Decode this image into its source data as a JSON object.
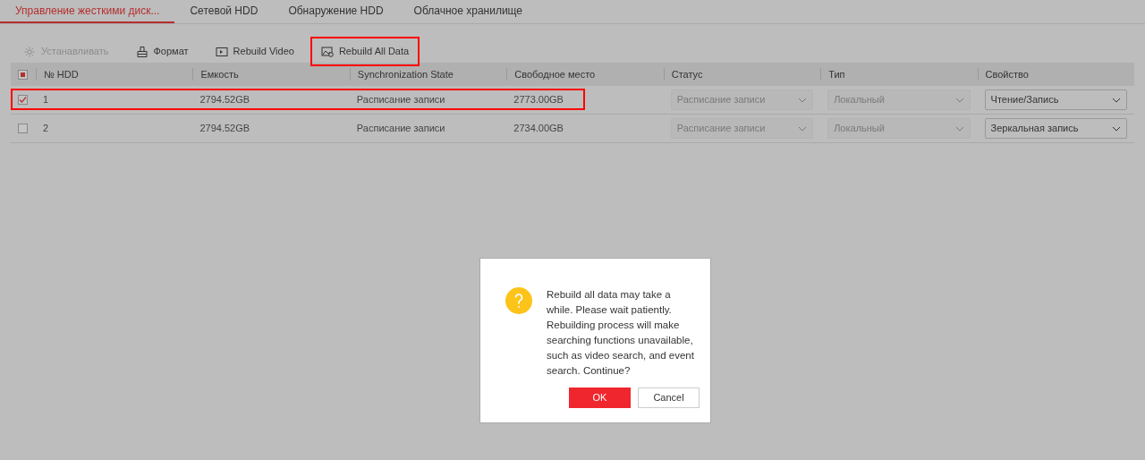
{
  "tabs": [
    {
      "label": "Управление жесткими диск...",
      "selected": true
    },
    {
      "label": "Сетевой HDD",
      "selected": false
    },
    {
      "label": "Обнаружение HDD",
      "selected": false
    },
    {
      "label": "Облачное хранилище",
      "selected": false
    }
  ],
  "toolbar": [
    {
      "label": "Устанавливать",
      "disabled": true,
      "highlighted": false
    },
    {
      "label": "Формат",
      "disabled": false,
      "highlighted": false
    },
    {
      "label": "Rebuild Video",
      "disabled": false,
      "highlighted": false
    },
    {
      "label": "Rebuild All Data",
      "disabled": false,
      "highlighted": true
    }
  ],
  "table": {
    "select_all": {
      "indeterminate": true
    },
    "columns": [
      "№ HDD",
      "Емкость",
      "Synchronization State",
      "Свободное место",
      "Статус",
      "Тип",
      "Свойство"
    ],
    "rows": [
      {
        "checked": true,
        "highlighted": true,
        "cells": [
          "1",
          "2794.52GB",
          "Расписание записи",
          "2773.00GB"
        ],
        "status": {
          "value": "Расписание записи",
          "disabled": true
        },
        "type": {
          "value": "Локальный",
          "disabled": true
        },
        "property": {
          "value": "Чтение/Запись",
          "disabled": false
        }
      },
      {
        "checked": false,
        "highlighted": false,
        "cells": [
          "2",
          "2794.52GB",
          "Расписание записи",
          "2734.00GB"
        ],
        "status": {
          "value": "Расписание записи",
          "disabled": true
        },
        "type": {
          "value": "Локальный",
          "disabled": true
        },
        "property": {
          "value": "Зеркальная запись",
          "disabled": false
        }
      }
    ]
  },
  "dialog": {
    "message": "Rebuild all data may take a while. Please wait patiently. Rebuilding process will make searching functions unavailable, such as video search, and event search. Continue?",
    "buttons": [
      {
        "label": "OK",
        "kind": "primary"
      },
      {
        "label": "Cancel",
        "kind": "secondary"
      }
    ]
  }
}
